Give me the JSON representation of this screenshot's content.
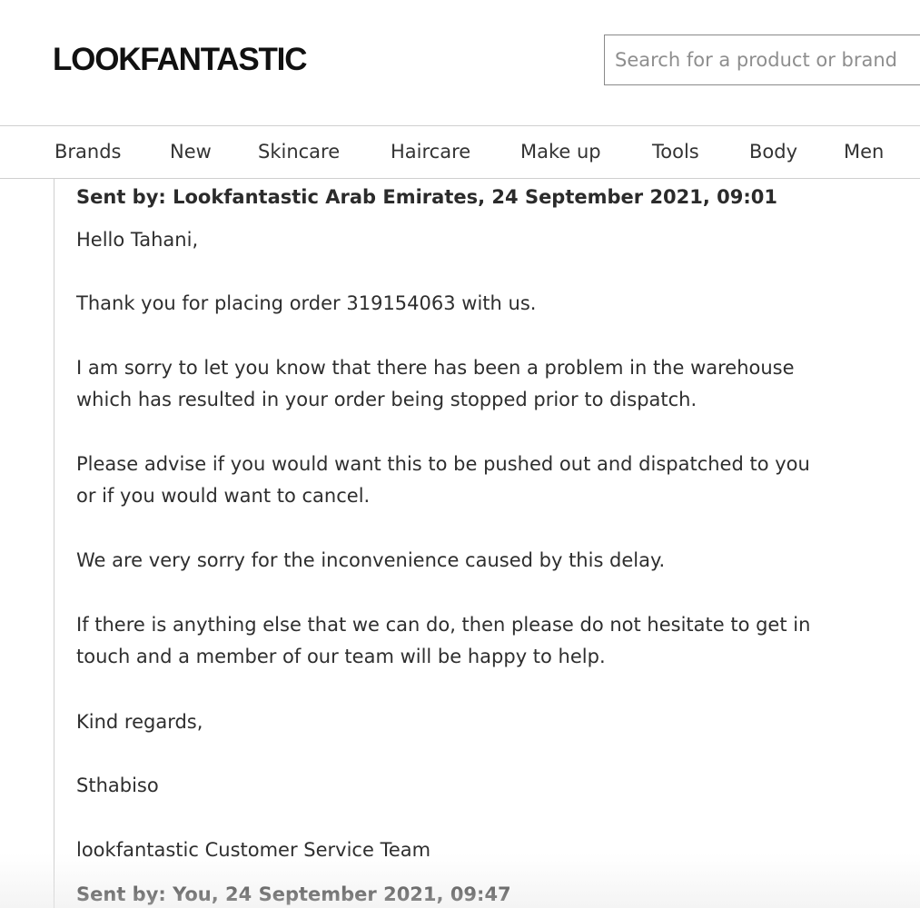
{
  "header": {
    "logo": "LOOKFANTASTIC",
    "search_placeholder": "Search for a product or brand"
  },
  "nav": {
    "items": [
      "Brands",
      "New",
      "Skincare",
      "Haircare",
      "Make up",
      "Tools",
      "Body",
      "Men"
    ]
  },
  "messages": [
    {
      "sent_by": "Sent by: Lookfantastic Arab Emirates, 24 September 2021, 09:01",
      "greeting": "Hello Tahani,",
      "p1": "Thank you for placing order 319154063 with us.",
      "p2_l1": "I am sorry to let you know that there has been a problem in the warehouse",
      "p2_l2": "which has resulted in your order being stopped prior to dispatch.",
      "p3_l1": "Please advise if you would want this to be pushed out and dispatched to you",
      "p3_l2": "or if you would want to cancel.",
      "p4": "We are very sorry for the inconvenience caused by this delay.",
      "p5_l1": "If there is anything else that we can do, then please do not hesitate to get in",
      "p5_l2": "touch and a member of our team will be happy to help.",
      "signoff": "Kind regards,",
      "agent": "Sthabiso",
      "team": "lookfantastic Customer Service Team"
    },
    {
      "sent_by": "Sent by: You, 24 September 2021, 09:47"
    }
  ]
}
